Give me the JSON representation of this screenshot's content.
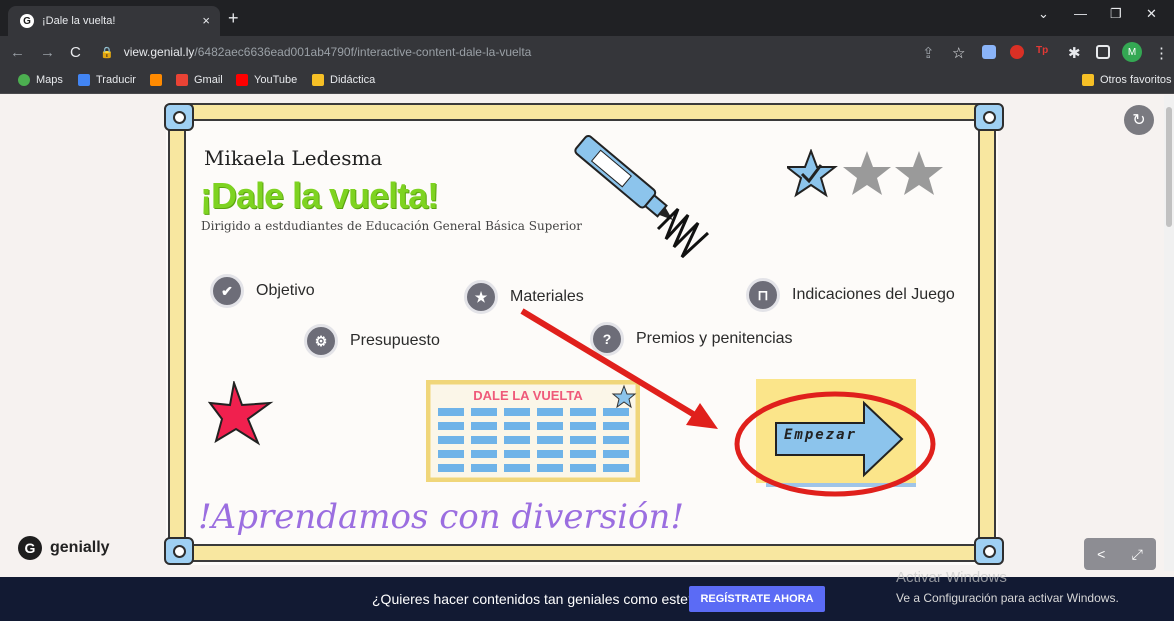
{
  "browser": {
    "tab_title": "¡Dale la vuelta!",
    "tab_close": "×",
    "new_tab": "+",
    "url_host": "view.genial.ly",
    "url_path": "/6482aec6636ead001ab4790f/interactive-content-dale-la-vuelta",
    "window_controls": [
      "⌄",
      "—",
      "❐",
      "✕"
    ],
    "bookmarks": [
      {
        "label": "Maps",
        "icon": "maps-icon",
        "color": "#4caf50"
      },
      {
        "label": "Traducir",
        "icon": "translate-icon",
        "color": "#4285f4"
      },
      {
        "label": "",
        "icon": "genially-icon",
        "color": "#ff8a00"
      },
      {
        "label": "Gmail",
        "icon": "gmail-icon",
        "color": "#ea4335"
      },
      {
        "label": "YouTube",
        "icon": "youtube-icon",
        "color": "#ff0000"
      },
      {
        "label": "Didáctica",
        "icon": "folder-icon",
        "color": "#f6c026"
      }
    ],
    "other_bookmarks": "Otros favoritos",
    "profile_initial": "M"
  },
  "content": {
    "author": "Mikaela Ledesma",
    "title": "¡Dale la vuelta!",
    "subtitle": "Dirigido a estdudiantes de Educación General Básica Superior",
    "menu": [
      {
        "label": "Objetivo",
        "icon": "check-icon",
        "glyph": "✔"
      },
      {
        "label": "Materiales",
        "icon": "star-icon",
        "glyph": "★"
      },
      {
        "label": "Indicaciones del Juego",
        "icon": "cart-icon",
        "glyph": "🛒"
      },
      {
        "label": "Presupuesto",
        "icon": "gear-icon",
        "glyph": "⚙"
      },
      {
        "label": "Premios y penitencias",
        "icon": "question-icon",
        "glyph": "?"
      }
    ],
    "board_title": "DALE LA VUELTA",
    "start_button": "Empezar",
    "footer": "!Aprendamos con diversión!"
  },
  "genially": {
    "logo_text": "genially",
    "logo_glyph": "G"
  },
  "cta": {
    "text": "¿Quieres hacer contenidos tan geniales como este?",
    "button": "REGÍSTRATE AHORA"
  },
  "windows_watermark": {
    "line1": "Activar Windows",
    "line2": "Ve a Configuración para activar Windows."
  },
  "colors": {
    "accent_green": "#7ed321",
    "arrow_red": "#e0201c",
    "frame_yellow": "#f8e7a0",
    "corner_blue": "#9fd0f3",
    "cta_blue": "#5b6bf5"
  }
}
